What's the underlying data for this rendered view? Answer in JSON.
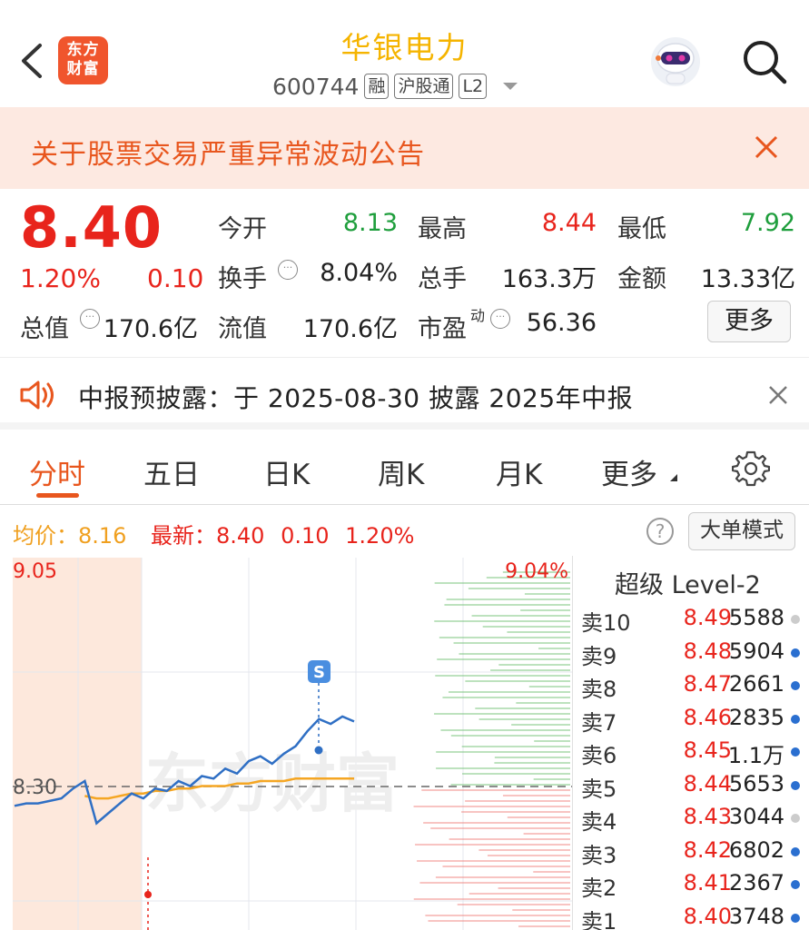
{
  "header": {
    "back_icon": "chevron-left-icon",
    "logo_line1": "东方",
    "logo_line2": "财富",
    "title": "华银电力",
    "code": "600744",
    "tags": [
      "融",
      "沪股通",
      "L2"
    ]
  },
  "notice": {
    "text": "关于股票交易严重异常波动公告"
  },
  "quote": {
    "price": "8.40",
    "change_pct": "1.20%",
    "change": "0.10",
    "open_label": "今开",
    "open": "8.13",
    "high_label": "最高",
    "high": "8.44",
    "low_label": "最低",
    "low": "7.92",
    "turnover_label": "换手",
    "turnover": "8.04%",
    "volume_label": "总手",
    "volume": "163.3万",
    "amount_label": "金额",
    "amount": "13.33亿",
    "mktcap_label": "总值",
    "mktcap": "170.6亿",
    "float_label": "流值",
    "float": "170.6亿",
    "pe_label": "市盈",
    "pe_sup": "动",
    "pe": "56.36",
    "more": "更多"
  },
  "announcement": {
    "text": "中报预披露：于 2025-08-30 披露 2025年中报"
  },
  "tabs": {
    "items": [
      "分时",
      "五日",
      "日K",
      "周K",
      "月K",
      "更多"
    ],
    "active": "分时"
  },
  "info": {
    "avg_label": "均价：",
    "avg": "8.16",
    "latest_label": "最新：",
    "latest": "8.40",
    "latest_change": "0.10",
    "latest_pct": "1.20%",
    "help": "?",
    "mode_button": "大单模式"
  },
  "chart_data": {
    "type": "line",
    "y_top_label": "9.05",
    "y_mid_label": "8.30",
    "right_top_pct": "9.04%",
    "watermark": "东方财富",
    "signal_marker": "S",
    "price_series": [
      8.05,
      8.06,
      8.06,
      8.07,
      8.08,
      8.12,
      8.15,
      7.98,
      8.02,
      8.06,
      8.1,
      8.08,
      8.12,
      8.11,
      8.15,
      8.13,
      8.17,
      8.16,
      8.2,
      8.18,
      8.23,
      8.25,
      8.22,
      8.26,
      8.29,
      8.35,
      8.4,
      8.38,
      8.41,
      8.39
    ],
    "avg_series": [
      8.06,
      8.06,
      8.06,
      8.06,
      8.07,
      8.08,
      8.09,
      8.08,
      8.08,
      8.09,
      8.1,
      8.1,
      8.11,
      8.11,
      8.12,
      8.12,
      8.13,
      8.13,
      8.13,
      8.14,
      8.14,
      8.15,
      8.15,
      8.15,
      8.16,
      8.16,
      8.16,
      8.16,
      8.16,
      8.16
    ],
    "ylim": [
      7.55,
      9.05
    ]
  },
  "level2": {
    "title": "超级 Level-2",
    "rows": [
      {
        "label": "卖10",
        "price": "8.49",
        "volume": "5588",
        "dot": "#cccccc"
      },
      {
        "label": "卖9",
        "price": "8.48",
        "volume": "5904",
        "dot": "#2a6fd0"
      },
      {
        "label": "卖8",
        "price": "8.47",
        "volume": "2661",
        "dot": "#2a6fd0"
      },
      {
        "label": "卖7",
        "price": "8.46",
        "volume": "2835",
        "dot": "#2a6fd0"
      },
      {
        "label": "卖6",
        "price": "8.45",
        "volume": "1.1万",
        "dot": "#2a6fd0"
      },
      {
        "label": "卖5",
        "price": "8.44",
        "volume": "5653",
        "dot": "#2a6fd0"
      },
      {
        "label": "卖4",
        "price": "8.43",
        "volume": "3044",
        "dot": "#cccccc"
      },
      {
        "label": "卖3",
        "price": "8.42",
        "volume": "6802",
        "dot": "#2a6fd0"
      },
      {
        "label": "卖2",
        "price": "8.41",
        "volume": "2367",
        "dot": "#2a6fd0"
      },
      {
        "label": "卖1",
        "price": "8.40",
        "volume": "3748",
        "dot": "#2a6fd0"
      }
    ]
  }
}
